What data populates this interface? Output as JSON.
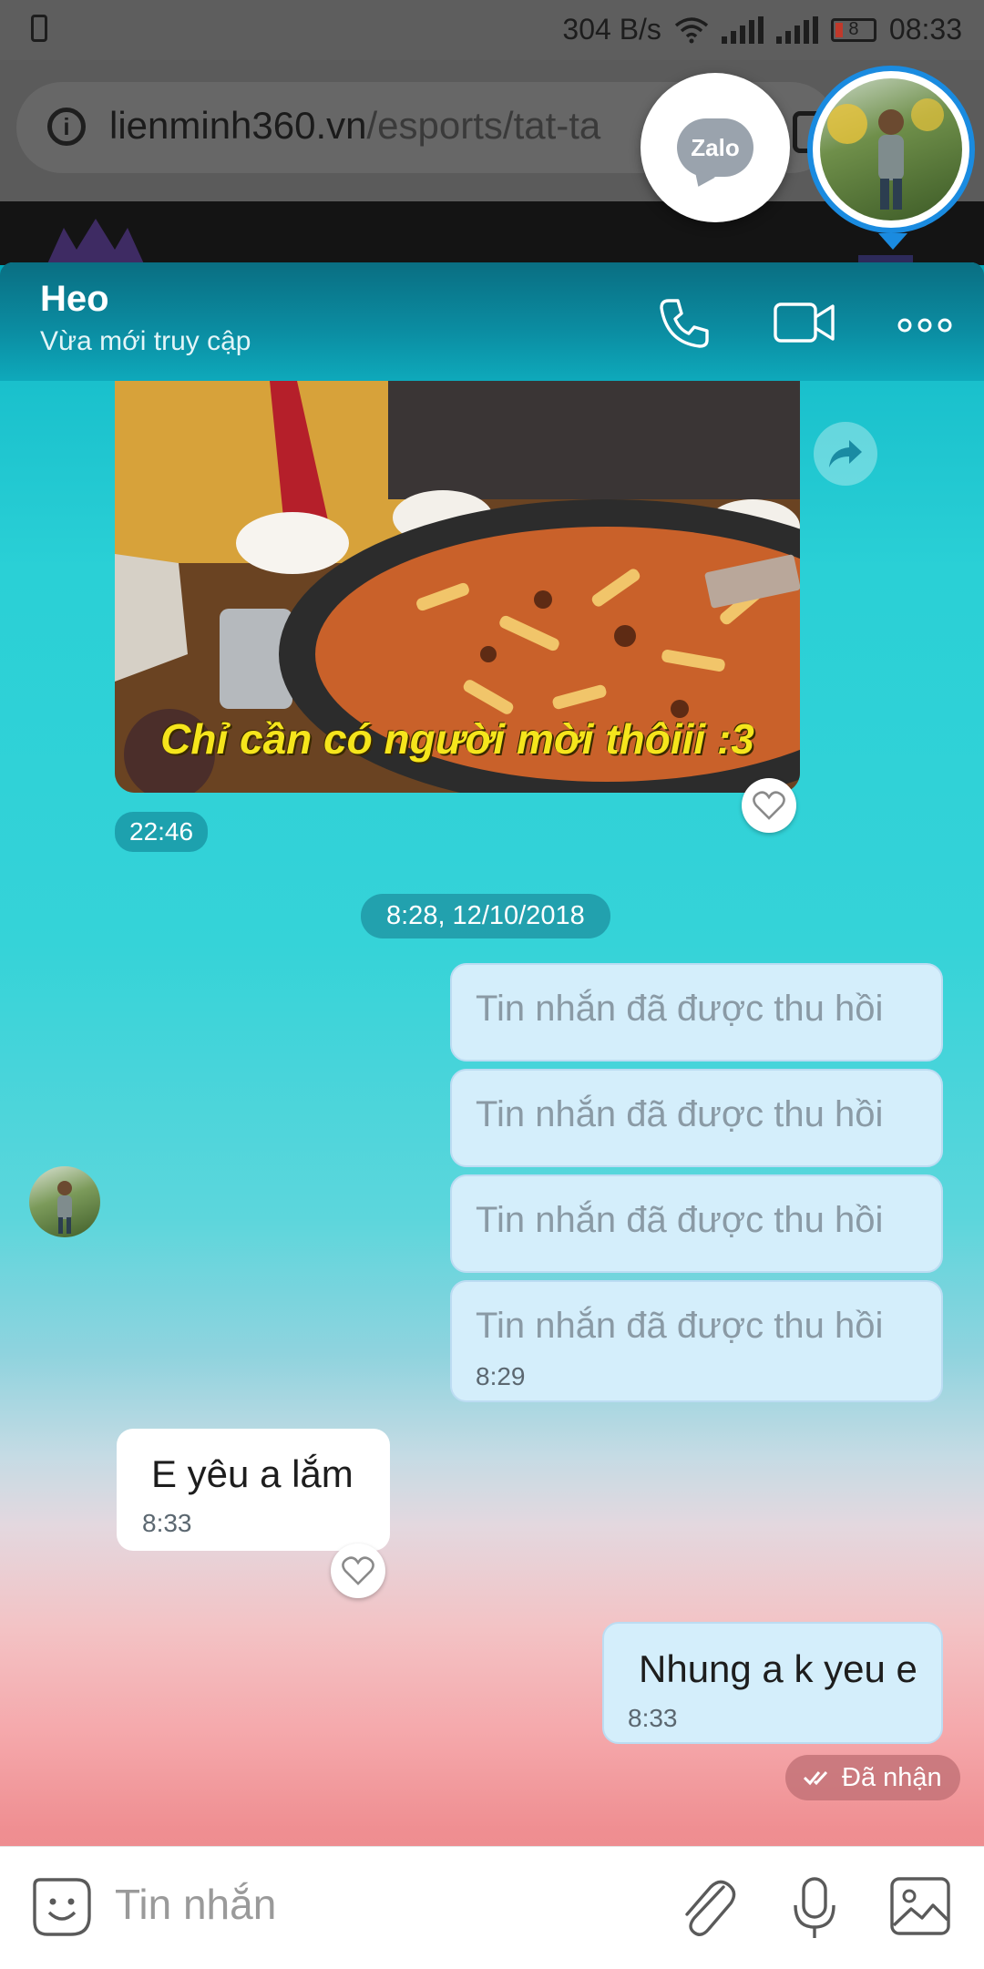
{
  "status_bar": {
    "net_speed": "304 B/s",
    "battery_level": "8",
    "time": "08:33"
  },
  "browser": {
    "url_host": "lienminh360.vn",
    "url_path": "/esports/tat-ta"
  },
  "zalo": {
    "badge_label": "Zalo"
  },
  "chat": {
    "contact_name": "Heo",
    "contact_status": "Vừa mới truy cập",
    "photo_caption": "Chỉ cần có người mời thôiii :3",
    "photo_time": "22:46",
    "date_separator": "8:28, 12/10/2018",
    "recalled_messages": [
      {
        "text": "Tin nhắn đã được thu hồi"
      },
      {
        "text": "Tin nhắn đã được thu hồi"
      },
      {
        "text": "Tin nhắn đã được thu hồi"
      },
      {
        "text": "Tin nhắn đã được thu hồi"
      }
    ],
    "recalled_time": "8:29",
    "incoming": {
      "text": "E yêu a lắm",
      "time": "8:33"
    },
    "outgoing": {
      "text": "Nhung a k yeu e",
      "time": "8:33"
    },
    "delivery_status": "Đã nhận"
  },
  "input": {
    "placeholder": "Tin nhắn"
  },
  "icons": {
    "call": "phone-icon",
    "video": "video-camera-icon",
    "more": "more-dots-icon",
    "share": "share-arrow-icon",
    "like": "heart-icon",
    "sticker": "sticker-smile-icon",
    "attach": "paperclip-icon",
    "voice": "microphone-icon",
    "gallery": "image-icon"
  },
  "colors": {
    "accent": "#1a8be0",
    "header": "#0a6e82",
    "outgoing_bubble": "#d4eefb",
    "incoming_bubble": "#ffffff"
  }
}
